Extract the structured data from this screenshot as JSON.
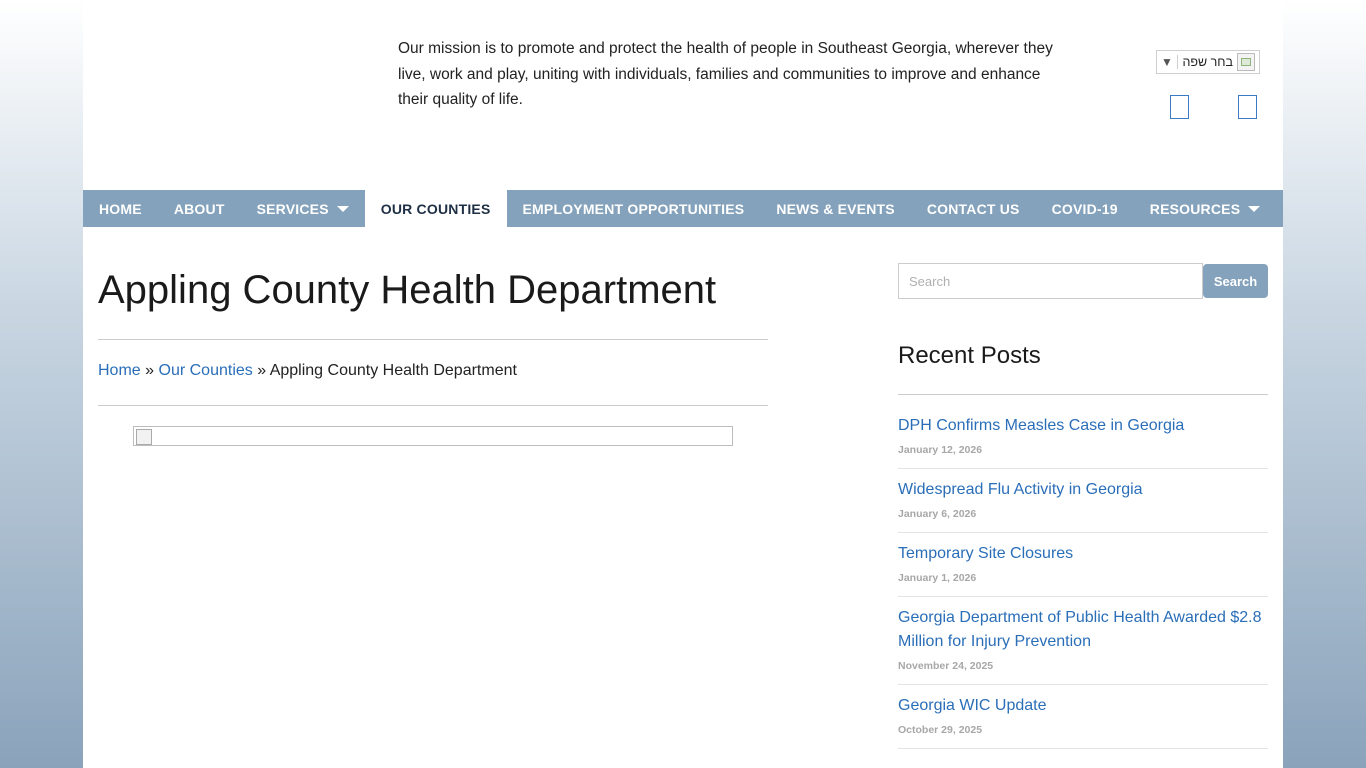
{
  "header": {
    "mission": "Our mission is to promote and protect the health of people in Southeast Georgia, wherever they live, work and play, uniting with individuals, families and communities to improve and enhance their quality of life.",
    "language_selector": {
      "label": "בחר שפה",
      "arrow": "▼",
      "icon": "flag-icon"
    }
  },
  "nav": {
    "items": [
      {
        "label": "HOME"
      },
      {
        "label": "ABOUT"
      },
      {
        "label": "SERVICES"
      },
      {
        "label": "OUR COUNTIES"
      },
      {
        "label": "EMPLOYMENT OPPORTUNITIES"
      },
      {
        "label": "NEWS & EVENTS"
      },
      {
        "label": "CONTACT US"
      },
      {
        "label": "COVID-19"
      },
      {
        "label": "RESOURCES"
      }
    ],
    "active": "OUR COUNTIES"
  },
  "main": {
    "title": "Appling County Health Department",
    "breadcrumb": {
      "home": "Home",
      "sep": "»",
      "section": "Our Counties",
      "current": "Appling County Health Department"
    }
  },
  "sidebar": {
    "search": {
      "placeholder": "Search",
      "button": "Search"
    },
    "recent_title": "Recent Posts",
    "posts": [
      {
        "title": "DPH Confirms Measles Case in Georgia",
        "date": "January 12, 2026"
      },
      {
        "title": "Widespread Flu Activity in Georgia",
        "date": "January 6, 2026"
      },
      {
        "title": "Temporary Site Closures",
        "date": "January 1, 2026"
      },
      {
        "title": "Georgia Department of Public Health Awarded $2.8 Million for Injury Prevention",
        "date": "November 24, 2025"
      },
      {
        "title": "Georgia WIC Update",
        "date": "October 29, 2025"
      }
    ]
  },
  "colors": {
    "nav_bg": "#84a2bb",
    "link": "#2a6eb8",
    "social_outline": "#3b7ac4"
  }
}
